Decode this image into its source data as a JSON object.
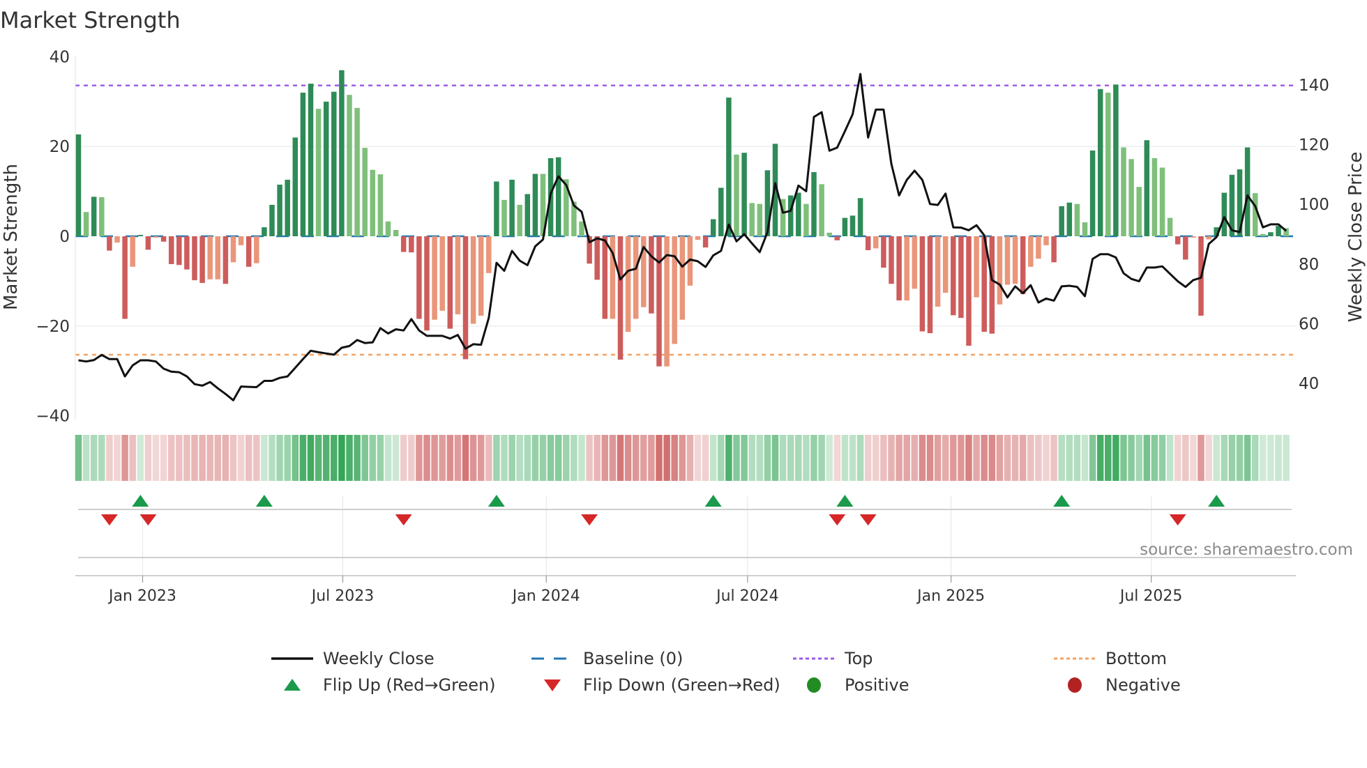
{
  "title": "Market Strength",
  "source": "source: sharemaestro.com",
  "chart_data": {
    "type": "bar",
    "title": "Market Strength",
    "frequency": "weekly",
    "start_date": "2022-11-04",
    "ylabel": "Market Strength",
    "y2label": "Weekly Close Price",
    "ylim": [
      -41,
      41
    ],
    "y2lim": [
      27.6,
      151
    ],
    "yticks": [
      40,
      20,
      0,
      -20,
      -40
    ],
    "ytick_labels": [
      "40",
      "20",
      "0",
      "−20",
      "−40"
    ],
    "y2ticks": [
      140,
      120,
      100,
      80,
      60,
      40
    ],
    "y2tick_labels": [
      "140",
      "120",
      "100",
      "80",
      "60",
      "40"
    ],
    "xticks": [
      {
        "date": "2023-01-01",
        "label": "Jan 2023"
      },
      {
        "date": "2023-07-01",
        "label": "Jul 2023"
      },
      {
        "date": "2024-01-01",
        "label": "Jan 2024"
      },
      {
        "date": "2024-07-01",
        "label": "Jul 2024"
      },
      {
        "date": "2025-01-01",
        "label": "Jan 2025"
      },
      {
        "date": "2025-07-01",
        "label": "Jul 2025"
      }
    ],
    "top_level": 33.6,
    "bottom_level": -26.4,
    "baseline": 0,
    "grid": true,
    "legend_position": "bottom",
    "strength": [
      22.7,
      5.4,
      8.8,
      8.7,
      -3.2,
      -1.4,
      -18.4,
      -6.8,
      0.3,
      -3,
      -0.3,
      -1.2,
      -6.2,
      -6.4,
      -7.4,
      -9.8,
      -10.4,
      -9.6,
      -9.6,
      -10.6,
      -5.8,
      -2,
      -6.8,
      -6,
      2,
      7,
      11.5,
      12.6,
      22,
      32,
      34,
      28.4,
      30,
      32.2,
      37,
      31.5,
      28.6,
      19.7,
      14.8,
      13.8,
      3.3,
      1.4,
      -3.5,
      -3.6,
      -18.4,
      -21,
      -18.6,
      -16.6,
      -20.6,
      -17.4,
      -27.4,
      -19.5,
      -17.7,
      -8.2,
      12.2,
      8.1,
      12.6,
      7,
      9.4,
      13.9,
      13.9,
      17.4,
      17.6,
      12.7,
      7.7,
      3.3,
      -6.1,
      -9.7,
      -18.4,
      -18.4,
      -27.5,
      -21.3,
      -18.4,
      -15.8,
      -17.2,
      -29,
      -29,
      -24,
      -18.6,
      -11,
      -0.8,
      -2.5,
      3.8,
      10.8,
      30.9,
      18.2,
      18.6,
      7.4,
      7.2,
      14.7,
      20.6,
      8.3,
      9.1,
      9.7,
      7.2,
      14.3,
      11.6,
      0.8,
      -0.9,
      4.1,
      4.6,
      8.5,
      -3.1,
      -2.7,
      -7,
      -10.6,
      -14.3,
      -14.3,
      -11.7,
      -21.2,
      -21.6,
      -15.7,
      -12.6,
      -17.6,
      -18.2,
      -24.4,
      -13.6,
      -21.3,
      -21.7,
      -15.2,
      -10.8,
      -10.6,
      -12.9,
      -6.8,
      -5,
      -2,
      -5.8,
      6.7,
      7.5,
      7.2,
      3.1,
      19.1,
      32.8,
      32,
      33.8,
      19.8,
      17.2,
      11,
      21.4,
      17.4,
      15.3,
      4.1,
      -1.8,
      -5.2,
      -0.3,
      -17.7,
      -0.7,
      2,
      9.7,
      13.7,
      14.9,
      19.8,
      9.6,
      0.5,
      0.9,
      2.3,
      1.8
    ],
    "weekly_close": [
      47.7,
      47.3,
      47.8,
      49.5,
      48.1,
      48.1,
      42.3,
      46,
      47.7,
      47.7,
      47.3,
      44.9,
      43.9,
      43.7,
      42.3,
      39.7,
      39.2,
      40.4,
      38.3,
      36.4,
      34.3,
      38.9,
      38.8,
      38.7,
      40.8,
      40.8,
      41.8,
      42.3,
      45.2,
      48.1,
      50.9,
      50.4,
      50,
      49.6,
      51.9,
      52.5,
      54.5,
      53.5,
      53.7,
      58.5,
      56.7,
      58.1,
      57.7,
      61.5,
      57.7,
      55.9,
      55.9,
      55.9,
      55,
      56.2,
      51.6,
      53.1,
      52.9,
      61.9,
      80.4,
      77.7,
      84.4,
      81.1,
      79.6,
      85.9,
      88.2,
      103.6,
      109.4,
      106.5,
      99.6,
      97.5,
      87.3,
      88.6,
      87.9,
      83.7,
      74.8,
      77.7,
      78.4,
      85.7,
      82.6,
      80.5,
      83,
      82.6,
      79.1,
      81.5,
      80.9,
      79,
      82.9,
      84.4,
      93.2,
      87.6,
      90,
      86.9,
      84,
      90.7,
      107.1,
      97.2,
      97.8,
      106.3,
      104.4,
      129.3,
      130.9,
      118,
      119,
      124.5,
      130.2,
      143.7,
      122.4,
      131.8,
      131.8,
      113.6,
      103,
      108.2,
      111.3,
      108.2,
      100.1,
      99.8,
      103.6,
      92.3,
      92.2,
      91.3,
      93,
      89.6,
      74.6,
      73.1,
      68.8,
      72.5,
      70.2,
      72.9,
      67.1,
      68.4,
      67.7,
      72.5,
      72.7,
      72.3,
      69.2,
      81.7,
      83.3,
      83.3,
      82.2,
      76.9,
      75,
      74.2,
      78.8,
      78.8,
      79.2,
      76.7,
      74.2,
      72.3,
      74.6,
      75.4,
      86.7,
      89,
      95.7,
      91.3,
      90.7,
      103,
      99.4,
      92.3,
      93.3,
      93.3,
      91.1
    ],
    "flip_up_weeks": [
      9,
      25,
      55,
      83,
      100,
      128,
      148
    ],
    "flip_down_weeks": [
      5,
      10,
      43,
      67,
      99,
      103,
      143
    ],
    "colors": {
      "pos_rising": "#2e8b57",
      "pos_falling": "#7fbf7b",
      "neg_rising": "#cd5c5c",
      "neg_falling": "#e9967a",
      "line": "#111111",
      "baseline": "#1f77b4",
      "top": "#9b5de5",
      "bottom": "#f4a261",
      "flip_up": "#1a9a4a",
      "flip_down": "#d62728",
      "positive": "#228b22",
      "negative": "#b22222"
    },
    "legend": [
      {
        "label": "Weekly Close",
        "key": "line"
      },
      {
        "label": "Baseline (0)",
        "key": "baseline"
      },
      {
        "label": "Top",
        "key": "top"
      },
      {
        "label": "Bottom",
        "key": "bottom"
      },
      {
        "label": "Flip Up (Red→Green)",
        "key": "flip_up"
      },
      {
        "label": "Flip Down (Green→Red)",
        "key": "flip_down"
      },
      {
        "label": "Positive",
        "key": "positive"
      },
      {
        "label": "Negative",
        "key": "negative"
      }
    ]
  }
}
